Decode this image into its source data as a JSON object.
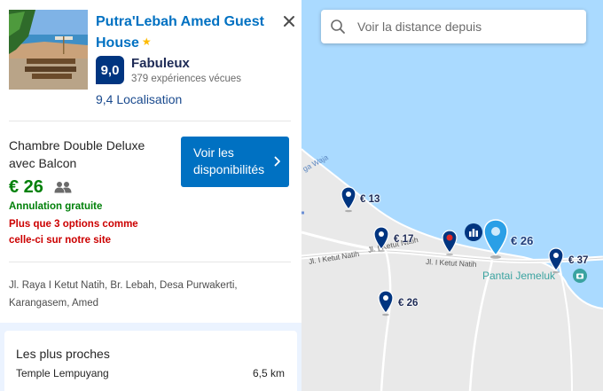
{
  "hotel": {
    "name": "Putra'Lebah Amed Guest House",
    "star": "★",
    "close_label": "✕",
    "score": "9,0",
    "score_word": "Fabuleux",
    "reviews": "379 expériences vécues",
    "location_score": "9,4 Localisation"
  },
  "room": {
    "name": "Chambre Double Deluxe avec Balcon",
    "availability_button": "Voir les disponibilités",
    "price": "€ 26",
    "free_cancellation": "Annulation gratuite",
    "scarcity": "Plus que 3 options comme celle-ci sur notre site"
  },
  "address": "Jl. Raya I Ketut Natih, Br. Lebah, Desa Purwakerti, Karangasem, Amed",
  "nearby": {
    "title": "Les plus proches",
    "items": [
      {
        "name": "Temple Lempuyang",
        "distance": "6,5 km"
      }
    ]
  },
  "map": {
    "search_placeholder": "Voir la distance depuis",
    "road_label_1": "Jl. I Ketut Natih",
    "road_label_2": "Jl. I Ketut Natih",
    "road_label_3": "Jl. I Ketut Natih",
    "coast_label": "ga Waja",
    "poi_label": "Pantai Jemeluk",
    "pins": [
      {
        "price": "€ 13"
      },
      {
        "price": "€ 17"
      },
      {
        "price": "€ 26"
      },
      {
        "price": "€ 37"
      },
      {
        "price": "€ 26"
      }
    ]
  },
  "colors": {
    "brand_blue": "#0071c2",
    "dark_blue": "#003580",
    "green": "#008009",
    "red": "#cc0000",
    "sea": "#aadaff"
  },
  "icons": {
    "close": "close-icon",
    "search": "search-icon",
    "people": "people-icon",
    "chevron": "chevron-right-icon",
    "map_pin": "map-pin-icon"
  }
}
